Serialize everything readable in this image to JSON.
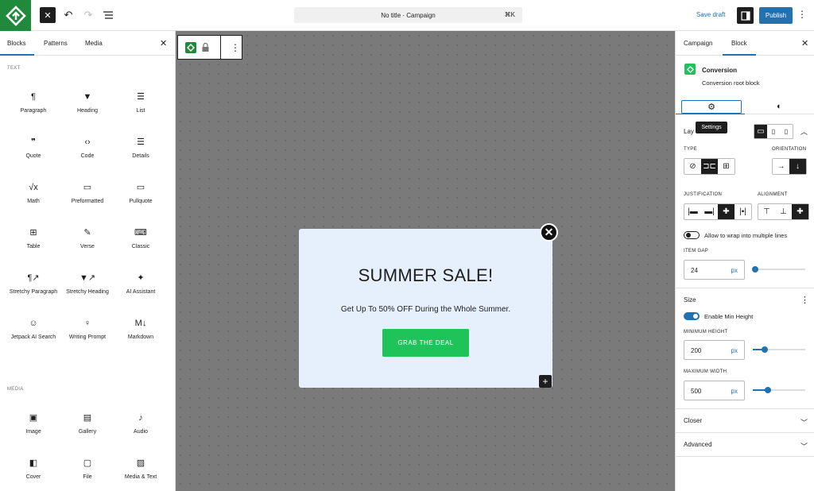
{
  "topbar": {
    "command_text": "No title · Campaign",
    "command_shortcut": "⌘K",
    "save_draft": "Save draft",
    "publish": "Publish"
  },
  "left_panel": {
    "tabs": [
      "Blocks",
      "Patterns",
      "Media"
    ],
    "text_section": "TEXT",
    "text_blocks": [
      {
        "icon": "paragraph-icon",
        "label": "Paragraph"
      },
      {
        "icon": "heading-icon",
        "label": "Heading"
      },
      {
        "icon": "list-icon",
        "label": "List"
      },
      {
        "icon": "quote-icon",
        "label": "Quote"
      },
      {
        "icon": "code-icon",
        "label": "Code"
      },
      {
        "icon": "details-icon",
        "label": "Details"
      },
      {
        "icon": "math-icon",
        "label": "Math"
      },
      {
        "icon": "preformatted-icon",
        "label": "Preformatted"
      },
      {
        "icon": "pullquote-icon",
        "label": "Pullquote"
      },
      {
        "icon": "table-icon",
        "label": "Table"
      },
      {
        "icon": "verse-icon",
        "label": "Verse"
      },
      {
        "icon": "classic-icon",
        "label": "Classic"
      },
      {
        "icon": "stretchy-paragraph-icon",
        "label": "Stretchy Paragraph"
      },
      {
        "icon": "stretchy-heading-icon",
        "label": "Stretchy Heading"
      },
      {
        "icon": "ai-assistant-icon",
        "label": "AI Assistant"
      },
      {
        "icon": "jetpack-ai-search-icon",
        "label": "Jetpack AI Search"
      },
      {
        "icon": "writing-prompt-icon",
        "label": "Writing Prompt"
      },
      {
        "icon": "markdown-icon",
        "label": "Markdown"
      }
    ],
    "media_section": "MEDIA",
    "media_blocks": [
      {
        "icon": "image-icon",
        "label": "Image"
      },
      {
        "icon": "gallery-icon",
        "label": "Gallery"
      },
      {
        "icon": "audio-icon",
        "label": "Audio"
      },
      {
        "icon": "cover-icon",
        "label": "Cover"
      },
      {
        "icon": "file-icon",
        "label": "File"
      },
      {
        "icon": "media-text-icon",
        "label": "Media & Text"
      }
    ]
  },
  "popup": {
    "title": "SUMMER SALE!",
    "subtitle": "Get Up To 50% OFF During the Whole Summer.",
    "cta": "GRAB THE DEAL"
  },
  "right_panel": {
    "tabs": [
      "Campaign",
      "Block"
    ],
    "block_name": "Conversion",
    "block_desc": "Conversion root block",
    "tooltip": "Settings",
    "layout_label": "Lay",
    "type_label": "TYPE",
    "orientation_label": "ORIENTATION",
    "justification_label": "JUSTIFICATION",
    "alignment_label": "ALIGNMENT",
    "wrap_label": "Allow to wrap into multiple lines",
    "wrap_enabled": false,
    "item_gap_label": "ITEM GAP",
    "item_gap": {
      "value": "24",
      "unit": "px",
      "slider_fraction": 0.02
    },
    "size_label": "Size",
    "min_height_toggle_label": "Enable Min Height",
    "min_height_enabled": true,
    "min_height_label": "MINIMUM HEIGHT",
    "min_height": {
      "value": "200",
      "unit": "px",
      "slider_fraction": 0.2
    },
    "max_width_label": "MAXIMUM WIDTH",
    "max_width": {
      "value": "500",
      "unit": "px",
      "slider_fraction": 0.25
    },
    "closer_label": "Closer",
    "advanced_label": "Advanced"
  },
  "colors": {
    "accent": "#2271b1",
    "brand": "#1f8a3c",
    "cta": "#1ec35a",
    "popup_bg": "#e5f0fc"
  }
}
